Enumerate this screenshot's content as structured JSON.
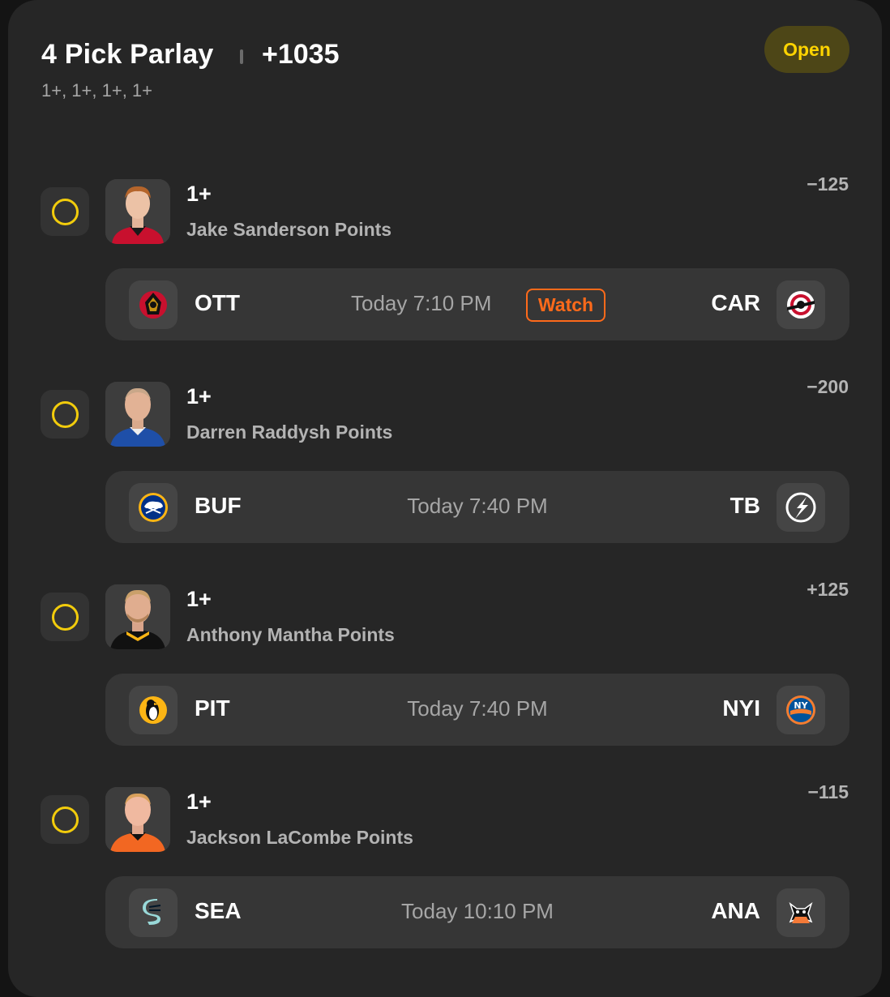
{
  "header": {
    "title": "4 Pick Parlay",
    "odds": "+1035",
    "subtitle": "1+, 1+, 1+, 1+",
    "status": "Open"
  },
  "picks": [
    {
      "line": "1+",
      "player": "Jake Sanderson Points",
      "odds": "−125",
      "jersey_color": "#c8102e",
      "game": {
        "away": "OTT",
        "home": "CAR",
        "time": "Today 7:10 PM",
        "watch_label": "Watch"
      }
    },
    {
      "line": "1+",
      "player": "Darren Raddysh Points",
      "odds": "−200",
      "jersey_color": "#1e4fa8",
      "game": {
        "away": "BUF",
        "home": "TB",
        "time": "Today 7:40 PM"
      }
    },
    {
      "line": "1+",
      "player": "Anthony Mantha Points",
      "odds": "+125",
      "jersey_color": "#111111",
      "game": {
        "away": "PIT",
        "home": "NYI",
        "time": "Today 7:40 PM"
      }
    },
    {
      "line": "1+",
      "player": "Jackson LaCombe Points",
      "odds": "−115",
      "jersey_color": "#f26722",
      "game": {
        "away": "SEA",
        "home": "ANA",
        "time": "Today 10:10 PM"
      }
    }
  ],
  "colors": {
    "accent_yellow": "#f2cc0c",
    "watch_orange": "#ff6a1a",
    "card_bg": "#262626"
  }
}
